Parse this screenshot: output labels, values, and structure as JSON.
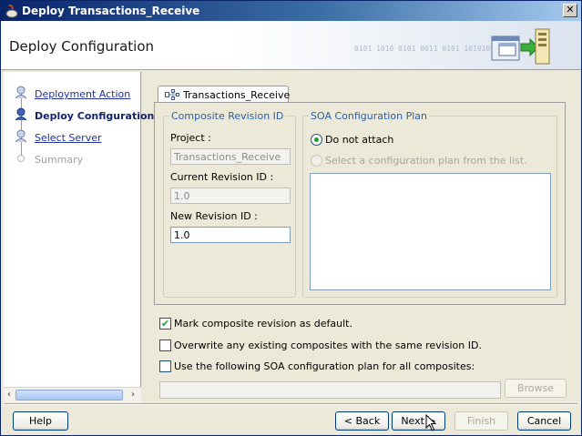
{
  "window": {
    "title": "Deploy Transactions_Receive",
    "close_glyph": "✕"
  },
  "header": {
    "title": "Deploy Configuration",
    "decoration": "0101 1010 0101 0011 0101 101010 01010101"
  },
  "nav": {
    "items": [
      {
        "label": "Deployment Action",
        "state": "link"
      },
      {
        "label": "Deploy Configuration",
        "state": "current"
      },
      {
        "label": "Select Server",
        "state": "link"
      },
      {
        "label": "Summary",
        "state": "disabled"
      }
    ],
    "scroll_left": "‹",
    "scroll_right": "›"
  },
  "tab": {
    "label": "Transactions_Receive",
    "icon": "composite-icon"
  },
  "composite_revision": {
    "legend": "Composite Revision ID",
    "project_label": "Project :",
    "project_value": "Transactions_Receive",
    "current_label": "Current Revision ID :",
    "current_value": "1.0",
    "new_label": "New Revision ID :",
    "new_value": "1.0"
  },
  "soa_plan": {
    "legend": "SOA Configuration Plan",
    "option_do_not_attach": "Do not attach",
    "option_select": "Select a configuration plan from the list.",
    "selected": "Do not attach"
  },
  "options": {
    "mark_default": {
      "label": "Mark composite revision as default.",
      "checked": true
    },
    "overwrite": {
      "label": "Overwrite any existing composites with the same revision ID.",
      "checked": false
    },
    "use_plan": {
      "label": "Use the following SOA configuration plan for all composites:",
      "checked": false
    },
    "plan_path": "",
    "browse_label": "Browse"
  },
  "buttons": {
    "help": "Help",
    "back": "< Back",
    "next": "Next >",
    "finish": "Finish",
    "cancel": "Cancel"
  },
  "colors": {
    "titlebar_start": "#0a246a",
    "link": "#22319b",
    "legend": "#2b5fa8",
    "check": "#21a121"
  }
}
